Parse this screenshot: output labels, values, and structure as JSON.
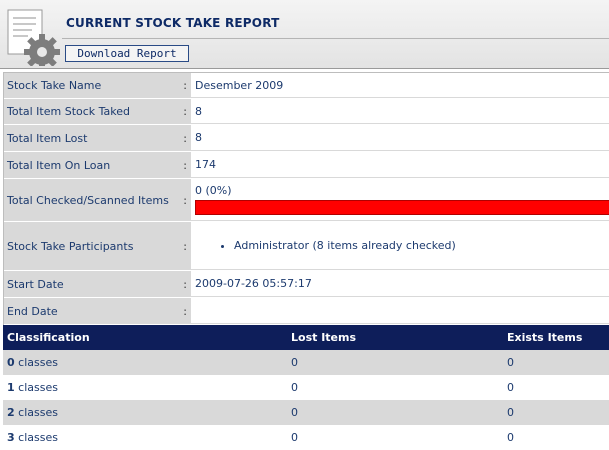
{
  "header": {
    "title": "CURRENT STOCK TAKE REPORT",
    "download_label": "Download Report"
  },
  "report": {
    "colon": ":",
    "rows": [
      {
        "label": "Stock Take Name",
        "value": "Desember 2009"
      },
      {
        "label": "Total Item Stock Taked",
        "value": "8"
      },
      {
        "label": "Total Item Lost",
        "value": "8"
      },
      {
        "label": "Total Item On Loan",
        "value": "174"
      },
      {
        "label": "Total Checked/Scanned Items",
        "value": "0 (0%)"
      },
      {
        "label": "Stock Take Participants",
        "value": "Administrator (8 items already checked)"
      },
      {
        "label": "Start Date",
        "value": "2009-07-26 05:57:17"
      },
      {
        "label": "End Date",
        "value": ""
      }
    ],
    "progress": {
      "percent": 0,
      "track_color": "#ff0000",
      "fill_color": "#0a7a0a"
    }
  },
  "classification": {
    "headers": [
      "Classification",
      "Lost Items",
      "Exists Items"
    ],
    "suffix": "classes",
    "rows": [
      {
        "code": "0",
        "lost": "0",
        "exists": "0"
      },
      {
        "code": "1",
        "lost": "0",
        "exists": "0"
      },
      {
        "code": "2",
        "lost": "0",
        "exists": "0"
      },
      {
        "code": "3",
        "lost": "0",
        "exists": "0"
      }
    ],
    "header_bg": "#0e1e5a",
    "odd_row_bg": "#d9d9d9"
  }
}
